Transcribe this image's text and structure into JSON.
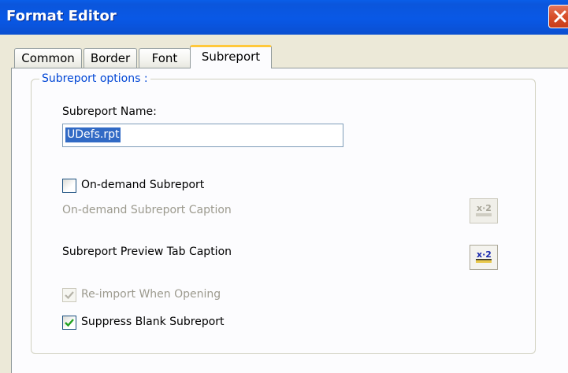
{
  "window": {
    "title": "Format Editor"
  },
  "tabs": [
    {
      "label": "Common",
      "active": false
    },
    {
      "label": "Border",
      "active": false
    },
    {
      "label": "Font",
      "active": false
    },
    {
      "label": "Subreport",
      "active": true
    }
  ],
  "group": {
    "label": "Subreport options :"
  },
  "subreport_name": {
    "label": "Subreport Name:",
    "value": "UDefs.rpt"
  },
  "on_demand": {
    "checkbox_label": "On-demand Subreport",
    "checked": false,
    "caption_label": "On-demand Subreport Caption",
    "formula_button_enabled": false
  },
  "preview_tab": {
    "caption_label": "Subreport Preview Tab Caption",
    "formula_button_enabled": true
  },
  "reimport": {
    "label": "Re-import When Opening",
    "checked": true,
    "enabled": false
  },
  "suppress_blank": {
    "label": "Suppress Blank Subreport",
    "checked": true,
    "enabled": true
  },
  "formula_button": {
    "glyph": "x·2"
  },
  "colors": {
    "titlebar": "#0958e6",
    "group_label": "#0046d5",
    "selection": "#316ac5",
    "check": "#21a121"
  }
}
